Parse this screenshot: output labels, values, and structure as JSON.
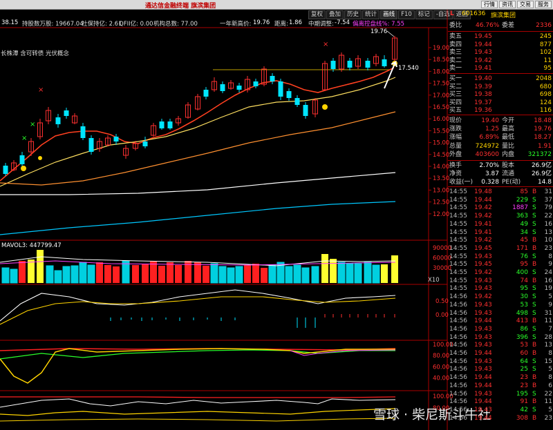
{
  "window": {
    "title": "通达信金融终端  旗滨集团"
  },
  "topmenu": [
    "行情",
    "资讯",
    "交易",
    "服务"
  ],
  "toolbar": {
    "items": [
      "复权",
      "叠加",
      "历史",
      "统计",
      "画线",
      "F10",
      "标记",
      "-自选",
      "返回"
    ]
  },
  "infobar": {
    "left_value": "38.15",
    "holders": "持股数万股: 19667.04",
    "social": "社保持亿: 2.61",
    "qfii": "QFII亿: 0.00",
    "inst": "机构总数: 77.00",
    "year_high_label": "一年新高价:",
    "year_high_value": "19.76",
    "distance_label": "距离:",
    "distance_value": "1.86",
    "mid_adjust_label": "中期调整:",
    "mid_adjust_value": "-7.54",
    "anomaly": "偏离控盘线%: 7.55"
  },
  "concept": "长株潭 含可转债 光伏概念",
  "chart_annotations": {
    "high": "19.76",
    "line_level": "17.540"
  },
  "price_axis": [
    "19.00",
    "18.50",
    "18.00",
    "17.50",
    "17.00",
    "16.50",
    "16.00",
    "15.50",
    "15.00",
    "14.50",
    "14.00",
    "13.50",
    "13.00",
    "12.50",
    "12.00"
  ],
  "volume": {
    "label": "MAVOL3: 447799.47",
    "axis": [
      "90000",
      "60000",
      "30000"
    ],
    "unit": "X10"
  },
  "macd_axis": [
    "0.50",
    "0.00"
  ],
  "kdj_axis": [
    "100.00",
    "80.00",
    "60.00",
    "40.00"
  ],
  "kdj2_axis": [
    "100.00",
    "80.00"
  ],
  "watermark": "雪球 · 柴尼斯斗牛社",
  "quote": {
    "flag": "L",
    "code": "601636",
    "name": "旗滨集团",
    "weibi_label": "委比",
    "weibi": "46.76%",
    "weicha_label": "委差",
    "weicha": "2336",
    "asks": [
      {
        "label": "卖五",
        "price": "19.45",
        "vol": "245"
      },
      {
        "label": "卖四",
        "price": "19.44",
        "vol": "877"
      },
      {
        "label": "卖三",
        "price": "19.43",
        "vol": "102"
      },
      {
        "label": "卖二",
        "price": "19.42",
        "vol": "11"
      },
      {
        "label": "卖一",
        "price": "19.41",
        "vol": "95"
      }
    ],
    "bids": [
      {
        "label": "买一",
        "price": "19.40",
        "vol": "2048"
      },
      {
        "label": "买二",
        "price": "19.39",
        "vol": "680"
      },
      {
        "label": "买三",
        "price": "19.38",
        "vol": "698"
      },
      {
        "label": "买四",
        "price": "19.37",
        "vol": "124"
      },
      {
        "label": "买五",
        "price": "19.36",
        "vol": "116"
      }
    ],
    "stats": [
      {
        "l1": "现价",
        "v1": "19.40",
        "l2": "今开",
        "v2": "18.48"
      },
      {
        "l1": "涨跌",
        "v1": "1.25",
        "l2": "最高",
        "v2": "19.76"
      },
      {
        "l1": "涨幅",
        "v1": "6.89%",
        "l2": "最低",
        "v2": "18.27"
      },
      {
        "l1": "总量",
        "v1": "724972",
        "l2": "量比",
        "v2": "1.91"
      },
      {
        "l1": "外盘",
        "v1": "403600",
        "l2": "内盘",
        "v2": "321372"
      }
    ],
    "stats2": [
      {
        "l1": "换手",
        "v1": "2.70%",
        "l2": "股本",
        "v2": "26.9亿"
      },
      {
        "l1": "净资",
        "v1": "3.87",
        "l2": "流通",
        "v2": "26.9亿"
      },
      {
        "l1": "收益(一)",
        "v1": "0.328",
        "l2": "PE(动)",
        "v2": "14.8"
      }
    ],
    "ticks": [
      {
        "t": "14:55",
        "p": "19.48",
        "v": "85",
        "s": "B",
        "n": "31"
      },
      {
        "t": "14:55",
        "p": "19.44",
        "v": "229",
        "s": "S",
        "n": "37"
      },
      {
        "t": "14:55",
        "p": "19.42",
        "v": "1887",
        "s": "S",
        "n": "79"
      },
      {
        "t": "14:55",
        "p": "19.42",
        "v": "363",
        "s": "S",
        "n": "22"
      },
      {
        "t": "14:55",
        "p": "19.41",
        "v": "49",
        "s": "S",
        "n": "16"
      },
      {
        "t": "14:55",
        "p": "19.41",
        "v": "34",
        "s": "S",
        "n": "13"
      },
      {
        "t": "14:55",
        "p": "19.42",
        "v": "45",
        "s": "B",
        "n": "10"
      },
      {
        "t": "14:55",
        "p": "19.45",
        "v": "171",
        "s": "B",
        "n": "23"
      },
      {
        "t": "14:55",
        "p": "19.43",
        "v": "76",
        "s": "S",
        "n": "8"
      },
      {
        "t": "14:55",
        "p": "19.45",
        "v": "95",
        "s": "B",
        "n": "9"
      },
      {
        "t": "14:55",
        "p": "19.42",
        "v": "400",
        "s": "S",
        "n": "24"
      },
      {
        "t": "14:55",
        "p": "19.43",
        "v": "74",
        "s": "B",
        "n": "16"
      },
      {
        "t": "14:55",
        "p": "19.43",
        "v": "95",
        "s": "S",
        "n": "19"
      },
      {
        "t": "14:56",
        "p": "19.42",
        "v": "30",
        "s": "S",
        "n": "5"
      },
      {
        "t": "14:56",
        "p": "19.43",
        "v": "53",
        "s": "S",
        "n": "9"
      },
      {
        "t": "14:56",
        "p": "19.43",
        "v": "498",
        "s": "S",
        "n": "31"
      },
      {
        "t": "14:56",
        "p": "19.44",
        "v": "413",
        "s": "B",
        "n": "11"
      },
      {
        "t": "14:56",
        "p": "19.43",
        "v": "86",
        "s": "S",
        "n": "7"
      },
      {
        "t": "14:56",
        "p": "19.43",
        "v": "396",
        "s": "S",
        "n": "28"
      },
      {
        "t": "14:56",
        "p": "19.43",
        "v": "53",
        "s": "B",
        "n": "13"
      },
      {
        "t": "14:56",
        "p": "19.44",
        "v": "60",
        "s": "B",
        "n": "8"
      },
      {
        "t": "14:56",
        "p": "19.43",
        "v": "64",
        "s": "S",
        "n": "15"
      },
      {
        "t": "14:56",
        "p": "19.43",
        "v": "25",
        "s": "S",
        "n": "5"
      },
      {
        "t": "14:56",
        "p": "19.44",
        "v": "23",
        "s": "B",
        "n": "8"
      },
      {
        "t": "14:56",
        "p": "19.44",
        "v": "23",
        "s": "B",
        "n": "6"
      },
      {
        "t": "14:56",
        "p": "19.43",
        "v": "195",
        "s": "S",
        "n": "22"
      },
      {
        "t": "14:56",
        "p": "19.44",
        "v": "91",
        "s": "B",
        "n": "11"
      },
      {
        "t": "14:56",
        "p": "19.43",
        "v": "42",
        "s": "S",
        "n": "5"
      },
      {
        "t": "14:56",
        "p": "19.44",
        "v": "308",
        "s": "B",
        "n": "23"
      }
    ]
  },
  "colors": {
    "up": "#ff3030",
    "down": "#00e5ff",
    "yellow": "#ffd400",
    "bg": "#000000"
  }
}
